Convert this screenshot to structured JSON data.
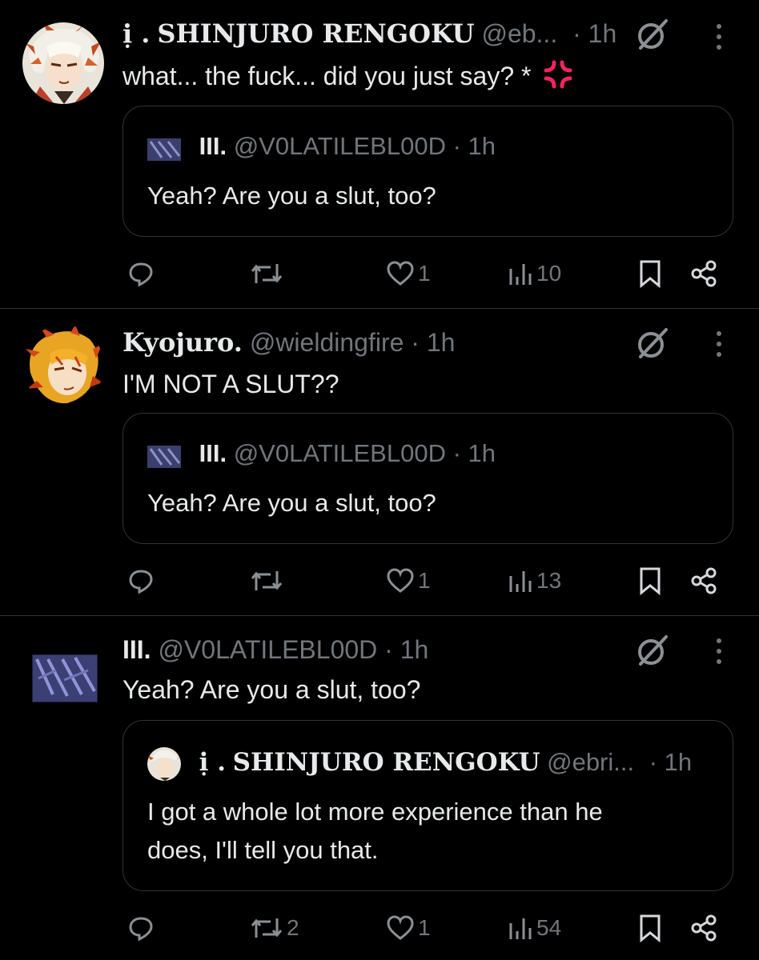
{
  "posts": [
    {
      "author_prefix": "ị .",
      "author_name": "SHINJURO RENGOKU",
      "handle": "@eb...",
      "time": "· 1h",
      "text": "what... the fuck... did you just say? *",
      "emoji": "anger-symbol",
      "quote": {
        "author_name": "III.",
        "handle": "@V0LATILEBL00D",
        "time": "· 1h",
        "text": "Yeah? Are you a slut, too?"
      },
      "actions": {
        "reply": "",
        "repost": "",
        "like": "1",
        "views": "10"
      }
    },
    {
      "author_name": "Kyojuro.",
      "handle": "@wieldingfire",
      "time": "· 1h",
      "text": "I'M NOT A SLUT??",
      "quote": {
        "author_name": "III.",
        "handle": "@V0LATILEBL00D",
        "time": "· 1h",
        "text": "Yeah? Are you a slut, too?"
      },
      "actions": {
        "reply": "",
        "repost": "",
        "like": "1",
        "views": "13"
      }
    },
    {
      "author_name": "III.",
      "handle": "@V0LATILEBL00D",
      "time": "· 1h",
      "text": "Yeah? Are you a slut, too?",
      "quote": {
        "author_prefix": "ị .",
        "author_name": "SHINJURO RENGOKU",
        "handle": "@ebri...",
        "time": "· 1h",
        "text_line1": "I got a whole lot more experience than he",
        "text_line2": "does, I'll tell you that."
      },
      "actions": {
        "reply": "",
        "repost": "2",
        "like": "1",
        "views": "54"
      }
    }
  ],
  "colors": {
    "background": "#000000",
    "text": "#e7e9ea",
    "muted": "#71767b",
    "border": "#2f3336",
    "anger": "#f4245e"
  }
}
